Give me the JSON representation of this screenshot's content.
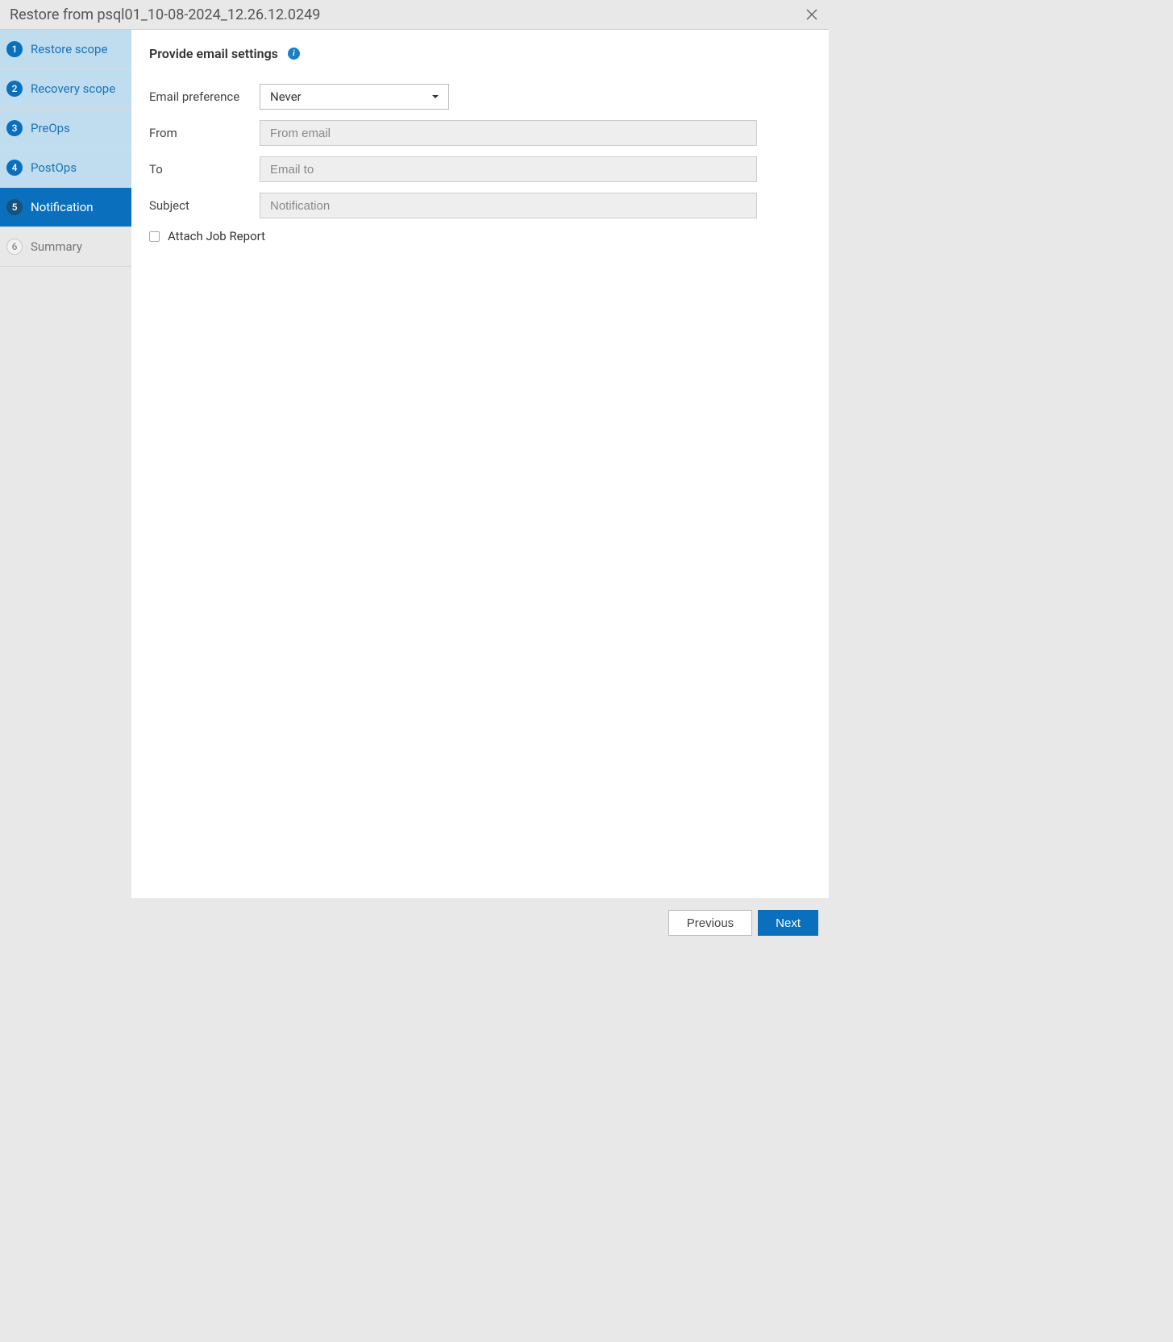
{
  "dialog": {
    "title": "Restore from psql01_10-08-2024_12.26.12.0249"
  },
  "sidebar": {
    "steps": [
      {
        "num": "1",
        "label": "Restore scope"
      },
      {
        "num": "2",
        "label": "Recovery scope"
      },
      {
        "num": "3",
        "label": "PreOps"
      },
      {
        "num": "4",
        "label": "PostOps"
      },
      {
        "num": "5",
        "label": "Notification"
      },
      {
        "num": "6",
        "label": "Summary"
      }
    ]
  },
  "content": {
    "title": "Provide email settings",
    "email_preference_label": "Email preference",
    "email_preference_value": "Never",
    "from_label": "From",
    "from_placeholder": "From email",
    "to_label": "To",
    "to_placeholder": "Email to",
    "subject_label": "Subject",
    "subject_placeholder": "Notification",
    "attach_job_label": "Attach Job Report"
  },
  "footer": {
    "previous": "Previous",
    "next": "Next"
  }
}
